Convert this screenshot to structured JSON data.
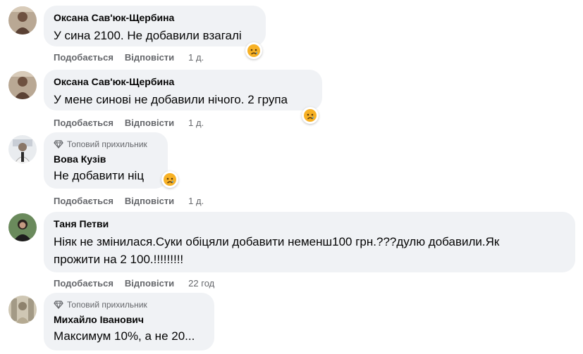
{
  "actions": {
    "like": "Подобається",
    "reply": "Відповісти"
  },
  "comments": [
    {
      "author": "Оксана Сав'юк-Щербина",
      "text": "У сина 2100. Не добавили взагалі",
      "time": "1 д.",
      "reaction": "sad-tear-icon"
    },
    {
      "author": "Оксана Сав'юк-Щербина",
      "text": "У мене синові не добавили нічого. 2 група",
      "time": "1 д.",
      "reaction": "sad-tear-icon"
    },
    {
      "badge": "Топовий прихильник",
      "author": "Вова Кузів",
      "text": "Не добавити ніц",
      "time": "1 д.",
      "reaction": "sad-tear-icon"
    },
    {
      "author": "Таня Петви",
      "text": "Ніяк не змінилася.Суки обіцяли добавити неменш100 грн.???дулю добавили.Як\nпрожити на 2 100.!!!!!!!!!",
      "time": "22 год"
    },
    {
      "badge": "Топовий прихильник",
      "author": "Михайло Іванович",
      "text": "Максимум 10%, а не 20..."
    }
  ],
  "colors": {
    "bubble": "#f0f2f5",
    "meta": "#65676b",
    "text": "#050505",
    "reaction": "#f7b125"
  }
}
